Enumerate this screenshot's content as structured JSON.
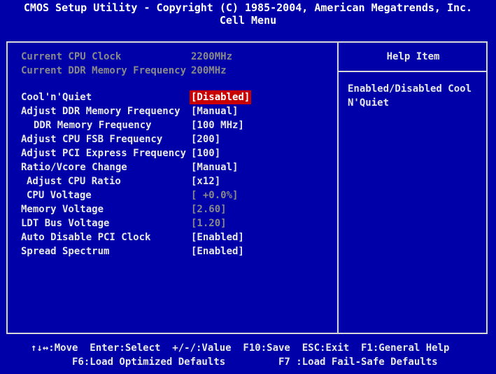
{
  "header": {
    "title_line1": "CMOS Setup Utility - Copyright (C) 1985-2004, American Megatrends, Inc.",
    "title_line2": "Cell Menu"
  },
  "info": [
    {
      "label": "Current CPU Clock",
      "value": "2200MHz"
    },
    {
      "label": "Current DDR Memory Frequency",
      "value": "200MHz"
    }
  ],
  "settings": [
    {
      "label": "Cool'n'Quiet",
      "value": "[Disabled]",
      "selected": true
    },
    {
      "label": "Adjust DDR Memory Frequency",
      "value": "[Manual]"
    },
    {
      "label": "DDR Memory Frequency",
      "value": "[100 MHz]"
    },
    {
      "label": "Adjust CPU FSB Frequency",
      "value": "[200]"
    },
    {
      "label": "Adjust PCI Express Frequency",
      "value": "[100]"
    },
    {
      "label": "Ratio/Vcore Change",
      "value": "[Manual]"
    },
    {
      "label": "Adjust CPU Ratio",
      "value": "[x12]"
    },
    {
      "label": "CPU Voltage",
      "value": "[ +0.0%]",
      "disabled": true
    },
    {
      "label": "Memory Voltage",
      "value": "[2.60]",
      "disabled": true
    },
    {
      "label": "LDT Bus Voltage",
      "value": "[1.20]",
      "disabled": true
    },
    {
      "label": "Auto Disable PCI Clock",
      "value": "[Enabled]"
    },
    {
      "label": "Spread Spectrum",
      "value": "[Enabled]"
    }
  ],
  "help": {
    "title": "Help Item",
    "text": "Enabled/Disabled Cool\nN'Quiet"
  },
  "footer": {
    "line1": "↑↓↔:Move  Enter:Select  +/-/:Value  F10:Save  ESC:Exit  F1:General Help",
    "line2": "F6:Load Optimized Defaults         F7 :Load Fail-Safe Defaults"
  },
  "colors": {
    "background": "#0000a8",
    "selected_bg": "#c80000",
    "text": "#e8e8e8",
    "disabled_text": "#8a8a8a"
  }
}
